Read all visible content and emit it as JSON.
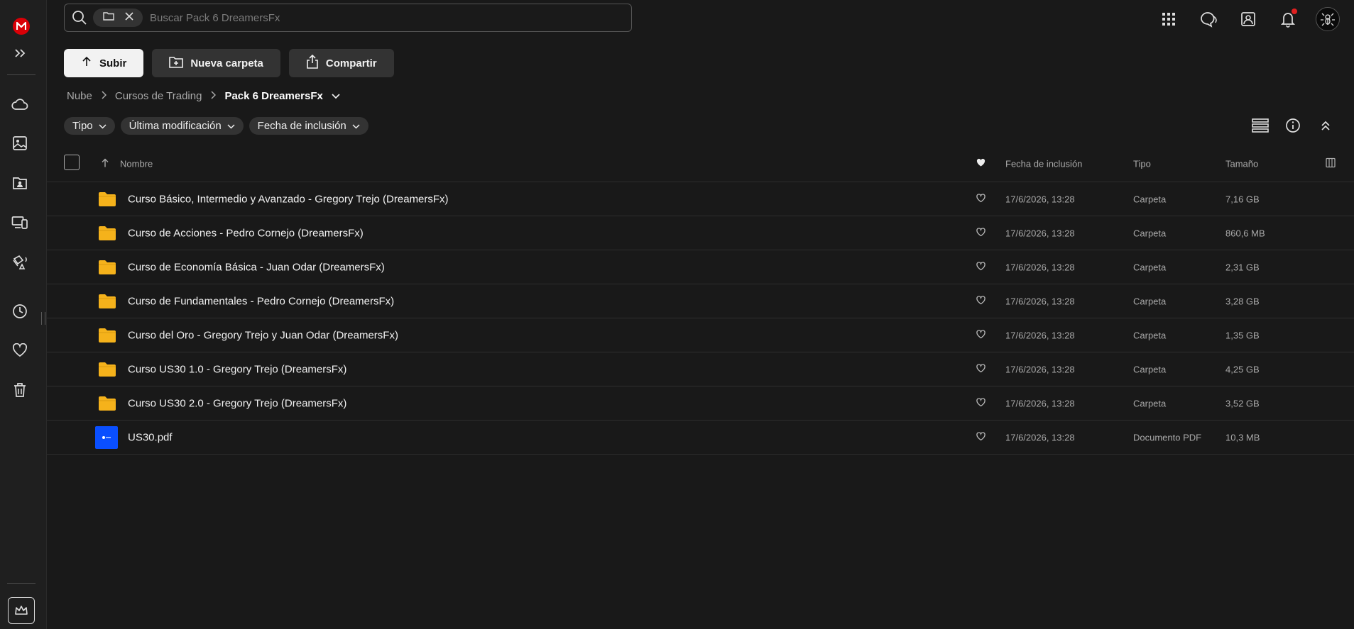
{
  "search": {
    "placeholder": "Buscar Pack 6 DreamersFx"
  },
  "actions": {
    "upload": "Subir",
    "new_folder": "Nueva carpeta",
    "share": "Compartir"
  },
  "breadcrumb": {
    "root": "Nube",
    "parent": "Cursos de Trading",
    "current": "Pack 6 DreamersFx"
  },
  "filters": {
    "type": "Tipo",
    "modified": "Última modificación",
    "added": "Fecha de inclusión"
  },
  "columns": {
    "name": "Nombre",
    "added": "Fecha de inclusión",
    "type": "Tipo",
    "size": "Tamaño"
  },
  "rows": [
    {
      "name": "Curso Básico, Intermedio y Avanzado - Gregory Trejo (DreamersFx)",
      "date": "17/6/2026, 13:28",
      "type": "Carpeta",
      "size": "7,16 GB"
    },
    {
      "name": "Curso de Acciones - Pedro Cornejo (DreamersFx)",
      "date": "17/6/2026, 13:28",
      "type": "Carpeta",
      "size": "860,6 MB"
    },
    {
      "name": "Curso de Economía Básica - Juan Odar (DreamersFx)",
      "date": "17/6/2026, 13:28",
      "type": "Carpeta",
      "size": "2,31 GB"
    },
    {
      "name": "Curso de Fundamentales - Pedro Cornejo (DreamersFx)",
      "date": "17/6/2026, 13:28",
      "type": "Carpeta",
      "size": "3,28 GB"
    },
    {
      "name": "Curso del Oro - Gregory Trejo y Juan Odar (DreamersFx)",
      "date": "17/6/2026, 13:28",
      "type": "Carpeta",
      "size": "1,35 GB"
    },
    {
      "name": "Curso US30 1.0 - Gregory Trejo (DreamersFx)",
      "date": "17/6/2026, 13:28",
      "type": "Carpeta",
      "size": "4,25 GB"
    },
    {
      "name": "Curso US30 2.0 - Gregory Trejo (DreamersFx)",
      "date": "17/6/2026, 13:28",
      "type": "Carpeta",
      "size": "3,52 GB"
    },
    {
      "name": "US30.pdf",
      "date": "17/6/2026, 13:28",
      "type": "Documento PDF",
      "size": "10,3 MB"
    }
  ],
  "colors": {
    "folder": "#f5b21b",
    "accent": "#d90007",
    "pdf_thumb": "#0a4fff"
  }
}
